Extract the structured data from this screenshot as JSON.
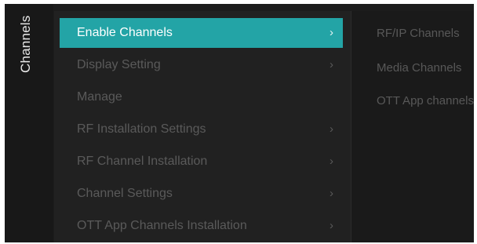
{
  "sidebar": {
    "title": "Channels"
  },
  "menu": {
    "items": [
      {
        "label": "Enable Channels",
        "chevron": "›"
      },
      {
        "label": "Display Setting",
        "chevron": "›"
      },
      {
        "label": "Manage",
        "chevron": ""
      },
      {
        "label": "RF Installation Settings",
        "chevron": "›"
      },
      {
        "label": "RF Channel Installation",
        "chevron": "›"
      },
      {
        "label": "Channel Settings",
        "chevron": "›"
      },
      {
        "label": "OTT App Channels Installation",
        "chevron": "›"
      }
    ]
  },
  "submenu": {
    "items": [
      {
        "label": "RF/IP Channels"
      },
      {
        "label": "Media Channels"
      },
      {
        "label": "OTT App channels"
      }
    ]
  },
  "colors": {
    "accent": "#23a4a6",
    "background": "#1c1c1c"
  }
}
